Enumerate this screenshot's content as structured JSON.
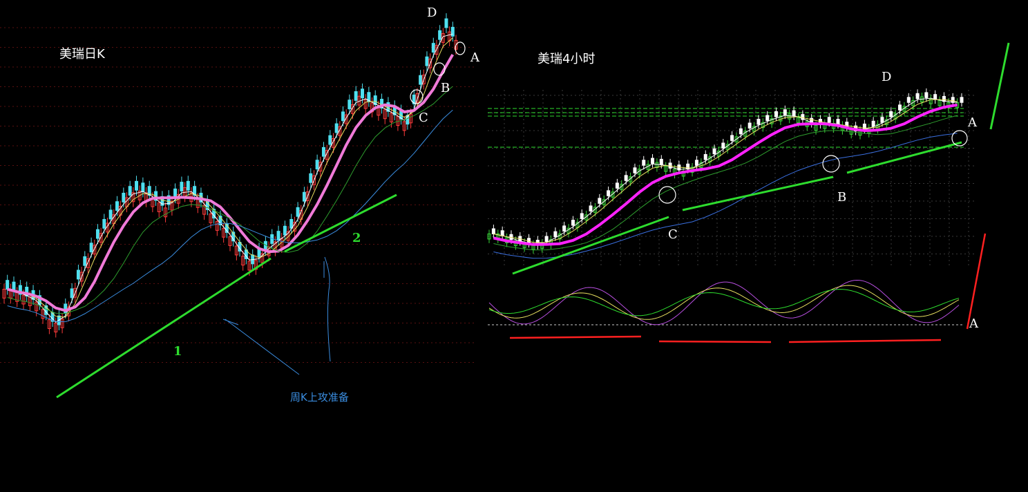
{
  "left_panel": {
    "title": "美瑞日K",
    "point_labels": [
      "D",
      "A",
      "B",
      "C"
    ],
    "trendline_labels": [
      "1",
      "2"
    ],
    "note": "周K上攻准备"
  },
  "right_panel": {
    "title": "美瑞4小时",
    "point_labels": [
      "D",
      "A",
      "B",
      "C"
    ],
    "oscillator_label": "A"
  },
  "colors": {
    "background": "#000000",
    "up_candle": "#ff3b3b",
    "down_candle": "#4fe0f0",
    "ma_pink": "#f07ad8",
    "ma_magenta": "#ff22ff",
    "trendline_green": "#2edc2e",
    "red_line": "#ff2020",
    "note_blue": "#3a8de0"
  },
  "chart_data": [
    {
      "type": "candlestick",
      "series": [
        {
          "name": "",
          "values": [
            12.2,
            12.0,
            11.9,
            11.6,
            11.0,
            10.8,
            11.5,
            12.6,
            13.4,
            14.2,
            14.8,
            15.3,
            15.8,
            16.1,
            16.0,
            15.7,
            15.4,
            15.8,
            16.2,
            15.9,
            15.5,
            15.0,
            14.6,
            14.1,
            13.5,
            13.2,
            13.6,
            14.0,
            14.2,
            14.6,
            15.3,
            16.4,
            17.2,
            17.9,
            18.6,
            19.3,
            19.8,
            19.6,
            19.4,
            19.2,
            19.0,
            18.7,
            19.9,
            21.0,
            21.8,
            22.5,
            22.0
          ]
        }
      ]
    },
    {
      "type": "candlestick",
      "series": [
        {
          "name": "",
          "values": [
            10.4,
            10.2,
            10.1,
            10.0,
            10.2,
            10.5,
            10.8,
            11.2,
            11.6,
            12.0,
            12.4,
            12.8,
            12.9,
            12.7,
            12.6,
            12.8,
            13.1,
            13.4,
            13.8,
            14.1,
            14.3,
            14.5,
            14.6,
            14.4,
            14.2,
            14.3,
            14.2,
            14.0,
            14.1,
            14.3,
            14.6,
            15.0,
            15.2,
            15.1,
            15.0,
            15.0
          ]
        }
      ]
    }
  ]
}
